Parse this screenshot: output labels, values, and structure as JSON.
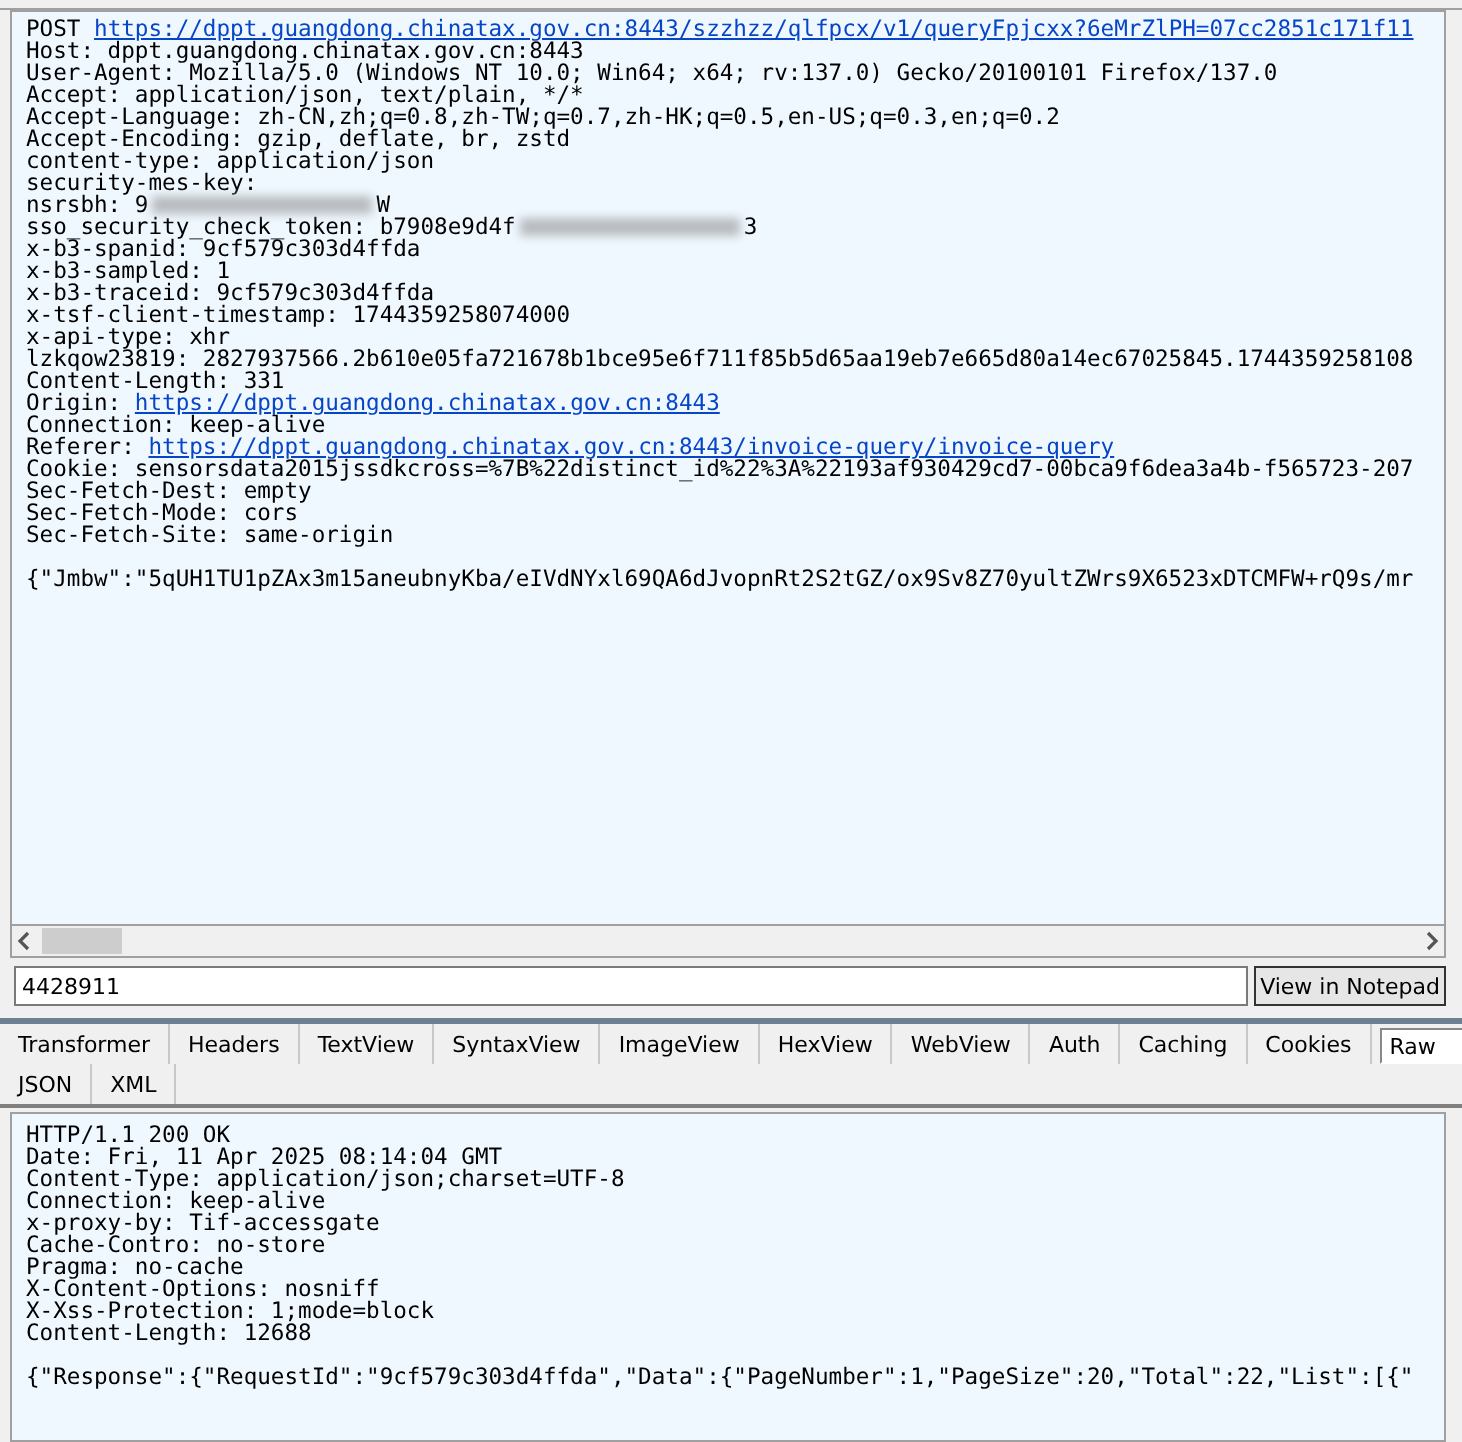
{
  "request": {
    "lines": [
      {
        "kind": "link",
        "text": "POST ",
        "link": "https://dppt.guangdong.chinatax.gov.cn:8443/szzhzz/qlfpcx/v1/queryFpjcxx?6eMrZlPH=07cc2851c171f11"
      },
      {
        "kind": "plain",
        "text": "Host: dppt.guangdong.chinatax.gov.cn:8443"
      },
      {
        "kind": "plain",
        "text": "User-Agent: Mozilla/5.0 (Windows NT 10.0; Win64; x64; rv:137.0) Gecko/20100101 Firefox/137.0"
      },
      {
        "kind": "plain",
        "text": "Accept: application/json, text/plain, */*"
      },
      {
        "kind": "plain",
        "text": "Accept-Language: zh-CN,zh;q=0.8,zh-TW;q=0.7,zh-HK;q=0.5,en-US;q=0.3,en;q=0.2"
      },
      {
        "kind": "plain",
        "text": "Accept-Encoding: gzip, deflate, br, zstd"
      },
      {
        "kind": "plain",
        "text": "content-type: application/json"
      },
      {
        "kind": "plain",
        "text": "security-mes-key:"
      },
      {
        "kind": "redacted",
        "text": "nsrsbh: 9",
        "tail": "W"
      },
      {
        "kind": "redacted",
        "text": "sso_security_check_token: b7908e9d4f",
        "tail": "3"
      },
      {
        "kind": "plain",
        "text": "x-b3-spanid: 9cf579c303d4ffda"
      },
      {
        "kind": "plain",
        "text": "x-b3-sampled: 1"
      },
      {
        "kind": "plain",
        "text": "x-b3-traceid: 9cf579c303d4ffda"
      },
      {
        "kind": "plain",
        "text": "x-tsf-client-timestamp: 1744359258074000"
      },
      {
        "kind": "plain",
        "text": "x-api-type: xhr"
      },
      {
        "kind": "plain",
        "text": "lzkqow23819: 2827937566.2b610e05fa721678b1bce95e6f711f85b5d65aa19eb7e665d80a14ec67025845.1744359258108"
      },
      {
        "kind": "plain",
        "text": "Content-Length: 331"
      },
      {
        "kind": "link",
        "text": "Origin: ",
        "link": "https://dppt.guangdong.chinatax.gov.cn:8443"
      },
      {
        "kind": "plain",
        "text": "Connection: keep-alive"
      },
      {
        "kind": "link",
        "text": "Referer: ",
        "link": "https://dppt.guangdong.chinatax.gov.cn:8443/invoice-query/invoice-query"
      },
      {
        "kind": "plain",
        "text": "Cookie: sensorsdata2015jssdkcross=%7B%22distinct_id%22%3A%22193af930429cd7-00bca9f6dea3a4b-f565723-207"
      },
      {
        "kind": "plain",
        "text": "Sec-Fetch-Dest: empty"
      },
      {
        "kind": "plain",
        "text": "Sec-Fetch-Mode: cors"
      },
      {
        "kind": "plain",
        "text": "Sec-Fetch-Site: same-origin"
      },
      {
        "kind": "blank"
      },
      {
        "kind": "plain",
        "text": "{\"Jmbw\":\"5qUH1TU1pZAx3m15aneubnyKba/eIVdNYxl69QA6dJvopnRt2S2tGZ/ox9Sv8Z70yultZWrs9X6523xDTCMFW+rQ9s/mr"
      }
    ]
  },
  "find": {
    "value": "4428911",
    "button": "View in Notepad"
  },
  "tabs": [
    {
      "label": "Transformer",
      "selected": false
    },
    {
      "label": "Headers",
      "selected": false
    },
    {
      "label": "TextView",
      "selected": false
    },
    {
      "label": "SyntaxView",
      "selected": false
    },
    {
      "label": "ImageView",
      "selected": false
    },
    {
      "label": "HexView",
      "selected": false
    },
    {
      "label": "WebView",
      "selected": false
    },
    {
      "label": "Auth",
      "selected": false
    },
    {
      "label": "Caching",
      "selected": false
    },
    {
      "label": "Cookies",
      "selected": false
    },
    {
      "label": "Raw",
      "selected": true
    }
  ],
  "tabs_row_2": [
    {
      "label": "JSON",
      "selected": false
    },
    {
      "label": "XML",
      "selected": false
    }
  ],
  "response": {
    "lines": [
      {
        "kind": "plain",
        "text": "HTTP/1.1 200 OK"
      },
      {
        "kind": "plain",
        "text": "Date: Fri, 11 Apr 2025 08:14:04 GMT"
      },
      {
        "kind": "plain",
        "text": "Content-Type: application/json;charset=UTF-8"
      },
      {
        "kind": "plain",
        "text": "Connection: keep-alive"
      },
      {
        "kind": "plain",
        "text": "x-proxy-by: Tif-accessgate"
      },
      {
        "kind": "plain",
        "text": "Cache-Contro: no-store"
      },
      {
        "kind": "plain",
        "text": "Pragma: no-cache"
      },
      {
        "kind": "plain",
        "text": "X-Content-Options: nosniff"
      },
      {
        "kind": "plain",
        "text": "X-Xss-Protection: 1;mode=block"
      },
      {
        "kind": "plain",
        "text": "Content-Length: 12688"
      },
      {
        "kind": "blank"
      },
      {
        "kind": "plain",
        "text": "{\"Response\":{\"RequestId\":\"9cf579c303d4ffda\",\"Data\":{\"PageNumber\":1,\"PageSize\":20,\"Total\":22,\"List\":[{\""
      }
    ]
  }
}
